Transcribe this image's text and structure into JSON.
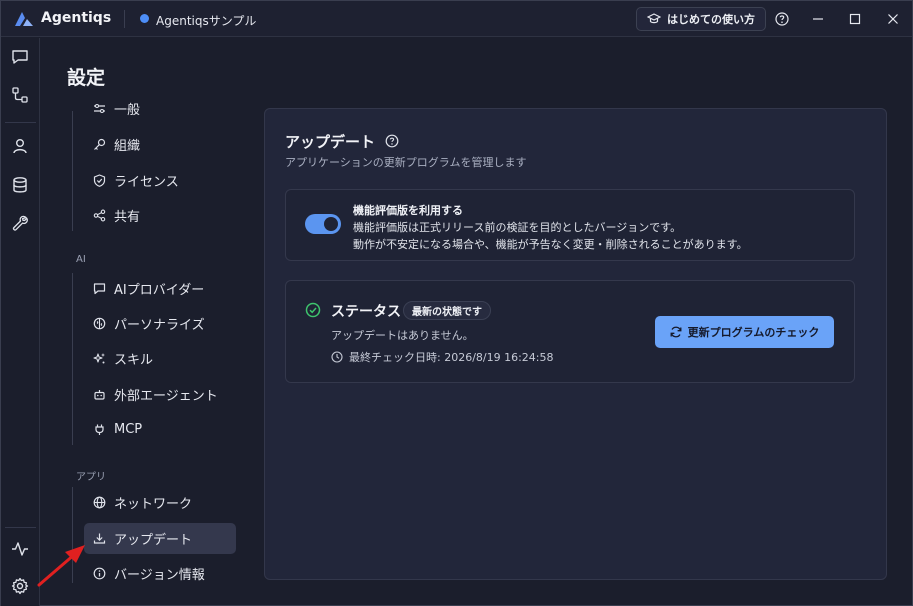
{
  "app": {
    "name": "Agentiqs",
    "workspace": "Agentiqsサンプル"
  },
  "titlebar": {
    "guide_label": "はじめての使い方"
  },
  "page": {
    "title": "設定"
  },
  "nav": {
    "top_items": [
      {
        "label": "一般"
      },
      {
        "label": "組織"
      },
      {
        "label": "ライセンス"
      },
      {
        "label": "共有"
      }
    ],
    "sections": [
      {
        "label": "AI",
        "items": [
          {
            "label": "AIプロバイダー"
          },
          {
            "label": "パーソナライズ"
          },
          {
            "label": "スキル"
          },
          {
            "label": "外部エージェント"
          },
          {
            "label": "MCP"
          }
        ]
      },
      {
        "label": "アプリ",
        "items": [
          {
            "label": "ネットワーク"
          },
          {
            "label": "アップデート"
          },
          {
            "label": "バージョン情報"
          }
        ]
      }
    ]
  },
  "panel": {
    "title": "アップデート",
    "subtitle": "アプリケーションの更新プログラムを管理します",
    "preview": {
      "title": "機能評価版を利用する",
      "desc1": "機能評価版は正式リリース前の検証を目的としたバージョンです。",
      "desc2": "動作が不安定になる場合や、機能が予告なく変更・削除されることがあります。",
      "enabled": true
    },
    "status": {
      "title": "ステータス",
      "badge": "最新の状態です",
      "message": "アップデートはありません。",
      "last_check": "最終チェック日時: 2026/8/19 16:24:58",
      "button": "更新プログラムのチェック"
    }
  },
  "colors": {
    "accent": "#5b95f0",
    "success": "#3ec46d",
    "annotation": "#e02020"
  }
}
